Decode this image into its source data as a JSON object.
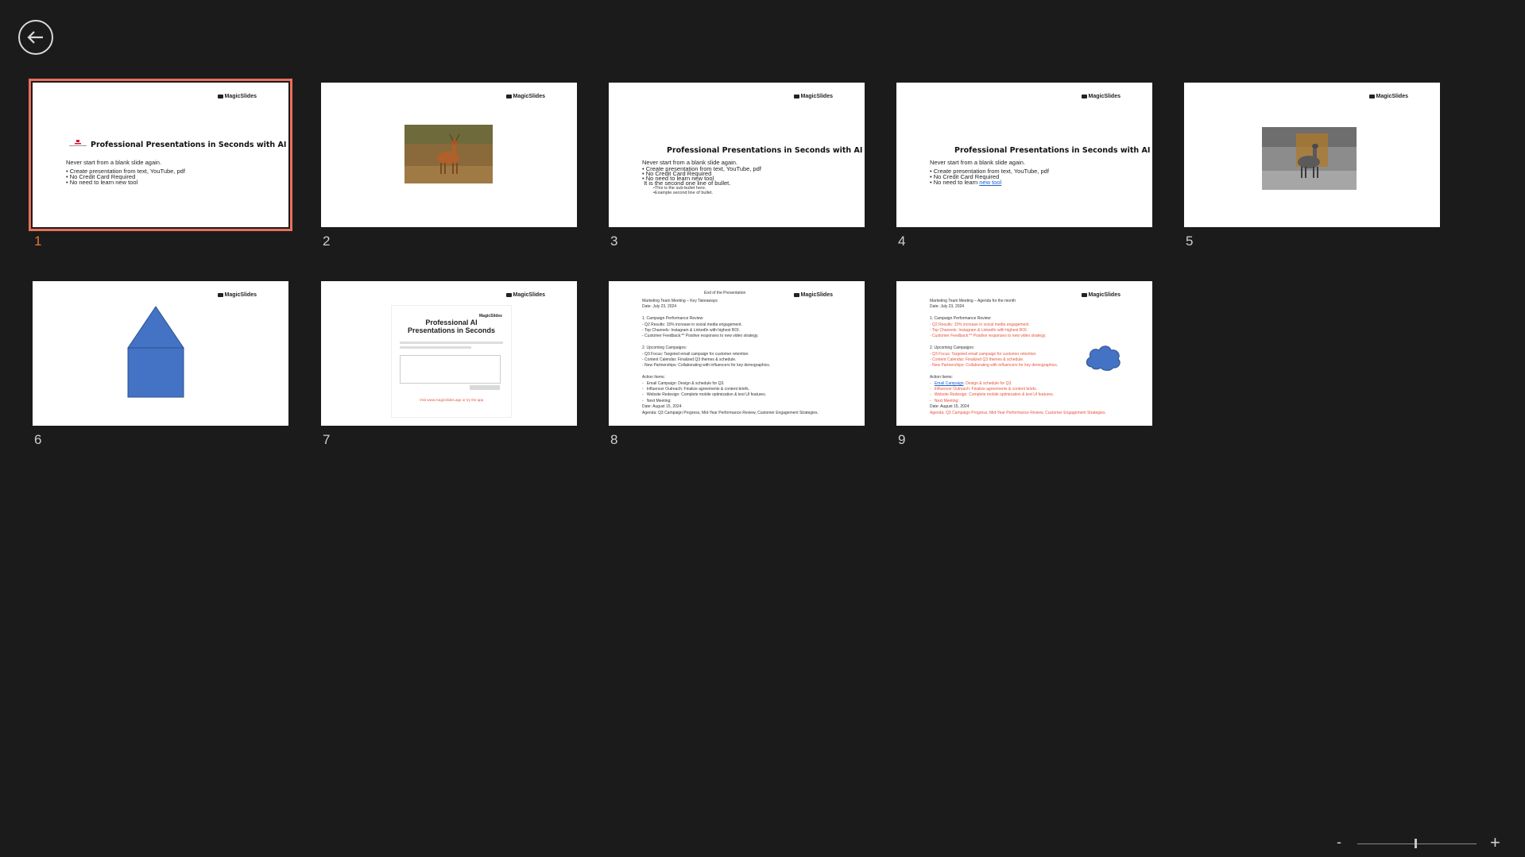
{
  "header": {
    "back_icon": "back-arrow-icon"
  },
  "logo_text": "MagicSlides",
  "slides": [
    {
      "number": "1",
      "selected": true,
      "title": "Professional Presentations in Seconds with AI",
      "body": [
        "Never start from a blank slide again.",
        "• Create presentation from text, YouTube, pdf",
        "• No Credit Card Required",
        "• No need to learn new tool"
      ]
    },
    {
      "number": "2",
      "image": "deer-photo"
    },
    {
      "number": "3",
      "title": "Professional Presentations in Seconds with AI",
      "body": [
        "Never start from a blank slide again.",
        "• Create presentation from text, YouTube, pdf",
        "• No Credit Card Required",
        "• No need to learn new tool",
        " It is the second one line of bullet."
      ],
      "sub": [
        "•This is the sub-bullet here.",
        "•Example second line of bullet."
      ]
    },
    {
      "number": "4",
      "title": "Professional Presentations in Seconds with AI",
      "body": [
        "Never start from a blank slide again.",
        "• Create presentation from text, YouTube, pdf",
        "• No Credit Card Required"
      ],
      "last_prefix": "• No need to learn ",
      "last_link": "new tool"
    },
    {
      "number": "5",
      "image": "grayscale-deer-photo"
    },
    {
      "number": "6",
      "shape": "house-shape"
    },
    {
      "number": "7",
      "title": "Professional AI\nPresentations in Seconds",
      "caption": "Visit www.magicslides.app or try the app"
    },
    {
      "number": "8",
      "header": "End of the Presentation",
      "body": [
        "Marketing Team Meeting – Key Takeaways",
        "Date: July 23, 2024",
        "",
        "1. Campaign Performance Review:",
        "- Q2 Results: 15% increase in social media engagement.",
        "- Top Channels: Instagram & LinkedIn with highest ROI.",
        "- Customer Feedback:** Positive responses to new video strategy.",
        "",
        "2. Upcoming Campaigns:",
        "- Q3 Focus: Targeted email campaign for customer retention.",
        "- Content Calendar: Finalized Q3 themes & schedule.",
        "- New Partnerships: Collaborating with influencers for key demographics.",
        "",
        "Action Items:",
        "-   Email Campaign: Design & schedule for Q3.",
        "-   Influencer Outreach: Finalize agreements & content briefs.",
        "-   Website Redesign: Complete mobile optimization & test UI features.",
        "-   Next Meeting:",
        "Date: August 15, 2024",
        "Agenda: Q3 Campaign Progress, Mid-Year Performance Review, Customer Engagement Strategies."
      ]
    },
    {
      "number": "9",
      "body_head": [
        "Marketing Team Meeting – Agenda for the month",
        "Date: July 23, 2024",
        "",
        "1. Campaign Performance Review:"
      ],
      "body_red1": [
        "- Q2 Results: 15% increase in social media engagement.",
        "- Top Channels: Instagram & LinkedIn with highest ROI.",
        "- Customer Feedback:** Positive responses to new video strategy."
      ],
      "body_mid": [
        "",
        "2. Upcoming Campaigns:"
      ],
      "body_red2": [
        "- Q3 Focus: Targeted email campaign for customer retention.",
        "- Content Calendar: Finalized Q3 themes & schedule.",
        "- New Partnerships: Collaborating with influencers for key demographics."
      ],
      "body_act": [
        "",
        "Action Items:"
      ],
      "action_link": "Email Campaign",
      "action_link_rest": ": Design & schedule for Q3.",
      "body_red3": [
        "-   Influencer Outreach: Finalize agreements & content briefs.",
        "-   Website Redesign: Complete mobile optimization & test UI features.",
        "-   Next Meeting:"
      ],
      "date": "Date: August 15, 2024",
      "agenda": "Agenda: Q3 Campaign Progress, Mid-Year Performance Review, Customer Engagement Strategies.",
      "shape": "cloud-shape"
    }
  ],
  "zoom": {
    "minus": "-",
    "plus": "+",
    "level": 0.55
  }
}
